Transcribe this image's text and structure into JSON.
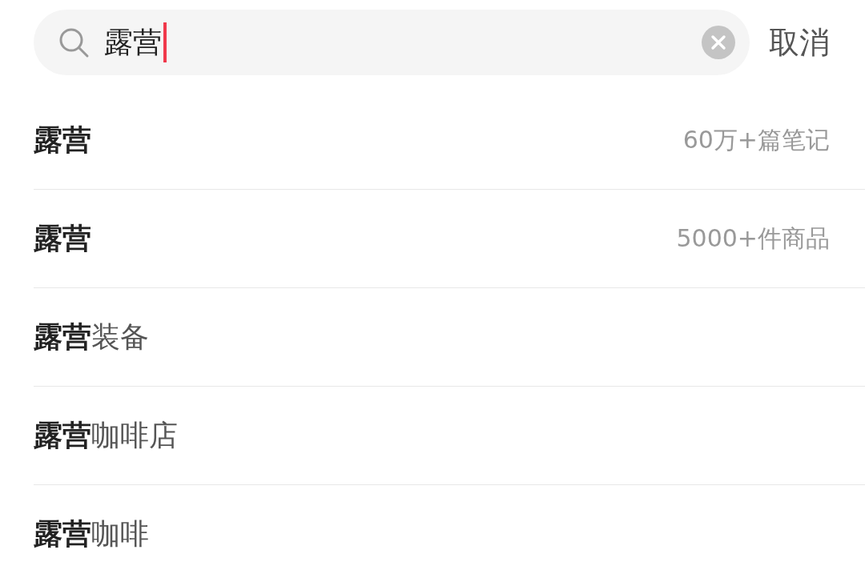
{
  "search": {
    "value": "露营",
    "cancel": "取消"
  },
  "suggestions": [
    {
      "text": "露营",
      "count": "60万+篇笔记"
    },
    {
      "text": "露营",
      "count": "5000+件商品"
    },
    {
      "text": "**露营**装备"
    },
    {
      "text": "**露营**咖啡店"
    },
    {
      "text": "**露营**咖啡"
    }
  ]
}
